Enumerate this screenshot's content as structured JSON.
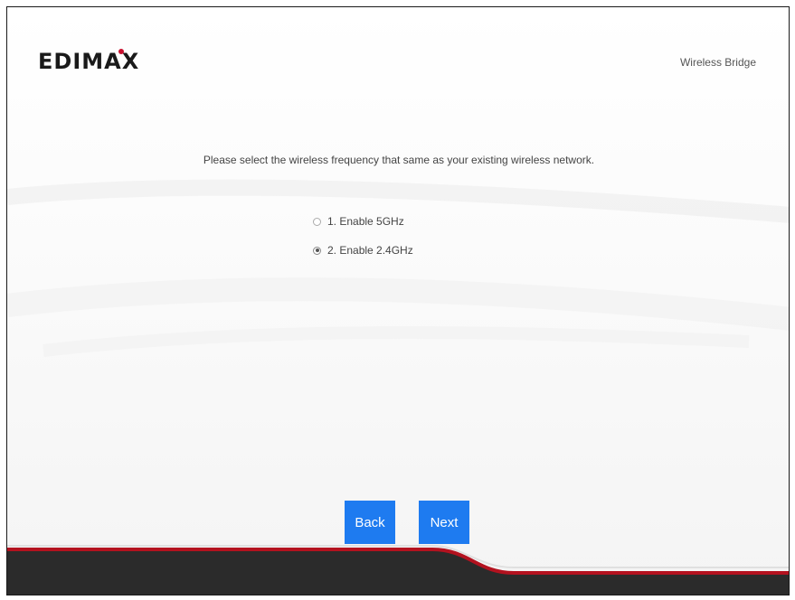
{
  "brand": {
    "logo_text": "EDIMAX",
    "accent_color": "#c8102e"
  },
  "header": {
    "product_title": "Wireless Bridge"
  },
  "main": {
    "instruction": "Please select the wireless frequency that same as your existing wireless network.",
    "options": [
      {
        "label": "1. Enable 5GHz",
        "checked": false
      },
      {
        "label": "2. Enable 2.4GHz",
        "checked": true
      }
    ]
  },
  "actions": {
    "back_label": "Back",
    "next_label": "Next",
    "button_color": "#1e7bf0"
  },
  "footer": {
    "band_color": "#2b2b2b",
    "stripe_color": "#b3121f"
  }
}
